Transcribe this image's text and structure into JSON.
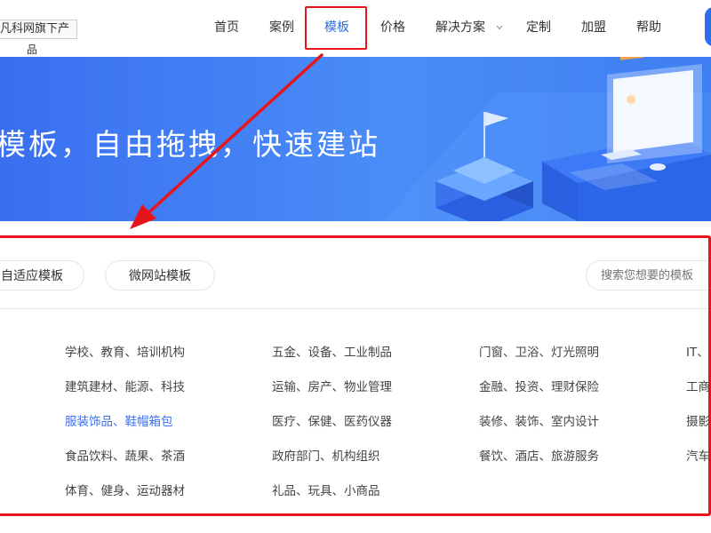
{
  "header": {
    "logo_line1": "凡科网旗下产",
    "logo_line2": "品",
    "nav": [
      {
        "label": "首页",
        "active": false
      },
      {
        "label": "案例",
        "active": false
      },
      {
        "label": "模板",
        "active": true
      },
      {
        "label": "价格",
        "active": false
      },
      {
        "label": "解决方案",
        "active": false,
        "dropdown": true
      },
      {
        "label": "定制",
        "active": false
      },
      {
        "label": "加盟",
        "active": false
      },
      {
        "label": "帮助",
        "active": false
      }
    ]
  },
  "banner": {
    "headline": "模板，自由拖拽，快速建站"
  },
  "filters": {
    "tabs": [
      "自适应模板",
      "微网站模板"
    ],
    "search_placeholder": "搜索您想要的模板"
  },
  "categories": {
    "columns": [
      [
        "学校、教育、培训机构",
        "建筑建材、能源、科技",
        "服装饰品、鞋帽箱包",
        "食品饮料、蔬果、茶酒",
        "体育、健身、运动器材"
      ],
      [
        "五金、设备、工业制品",
        "运输、房产、物业管理",
        "医疗、保健、医药仪器",
        "政府部门、机构组织",
        "礼品、玩具、小商品"
      ],
      [
        "门窗、卫浴、灯光照明",
        "金融、投资、理财保险",
        "装修、装饰、室内设计",
        "餐饮、酒店、旅游服务"
      ],
      [
        "IT、",
        "工商",
        "摄影",
        "汽车"
      ]
    ],
    "active": "服装饰品、鞋帽箱包"
  },
  "colors": {
    "accent": "#3a6ff0",
    "annotation": "#e8141b",
    "banner": "#4a8df7"
  }
}
